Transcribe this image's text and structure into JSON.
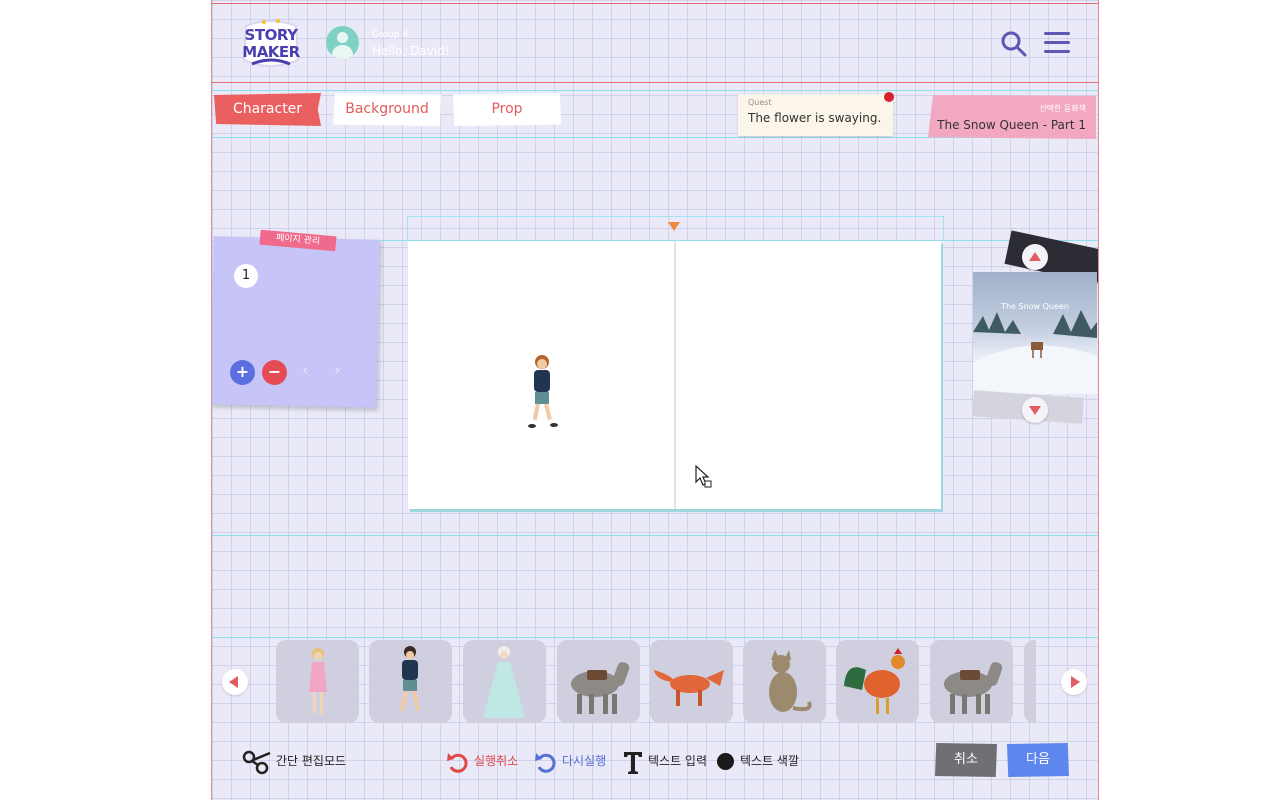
{
  "header": {
    "logo_line1": "STORY",
    "logo_line2": "MAKER",
    "group_label": "Group 4",
    "greeting": "Hello, David!"
  },
  "tabs": [
    {
      "label": "Character",
      "active": true
    },
    {
      "label": "Background",
      "active": false
    },
    {
      "label": "Prop",
      "active": false
    }
  ],
  "quest": {
    "label": "Quest",
    "text": "The flower is swaying."
  },
  "selected_story": {
    "label": "선택한 동화책",
    "title": "The Snow Queen - Part 1"
  },
  "page_manager": {
    "tag": "페이지 관리",
    "current_page": "1",
    "add_label": "+",
    "remove_label": "−",
    "prev_label": "‹",
    "next_label": "›"
  },
  "story_stack": {
    "cover_title": "The Snow Queen"
  },
  "thumbnails": [
    {
      "name": "girl-pink-dress"
    },
    {
      "name": "boy-blue-sweater"
    },
    {
      "name": "snow-queen-princess"
    },
    {
      "name": "donkey-with-saddle"
    },
    {
      "name": "fox"
    },
    {
      "name": "cat"
    },
    {
      "name": "rooster"
    },
    {
      "name": "donkey-with-saddle"
    }
  ],
  "toolbar": {
    "easy_edit": "간단 편집모드",
    "undo": "실행취소",
    "redo": "다시실행",
    "text_input": "텍스트 입력",
    "text_color": "텍스트 색깔",
    "cancel": "취소",
    "next": "다음"
  },
  "colors": {
    "accent_red": "#ea5f5f",
    "accent_blue": "#5d86ee",
    "brand_purple": "#4a3fb0",
    "note_purple": "#c7c4f8",
    "selected_pink": "#f3a8c2"
  }
}
